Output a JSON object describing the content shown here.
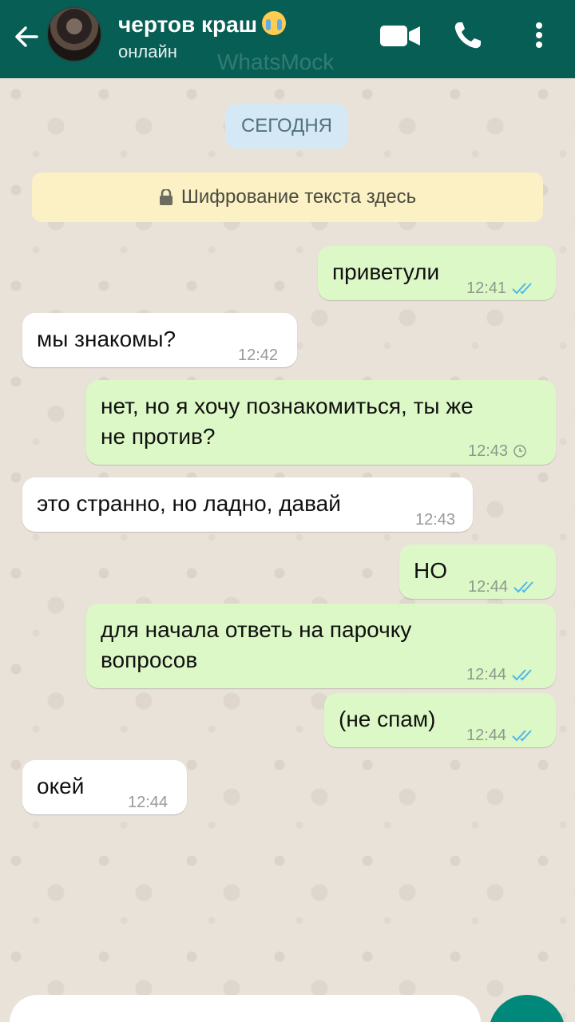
{
  "header": {
    "contact_name": "чертов краш",
    "status": "онлайн",
    "watermark": "WhatsMock",
    "icons": [
      "back-arrow-icon",
      "video-call-icon",
      "phone-icon",
      "more-vert-icon"
    ]
  },
  "chat": {
    "date_label": "СЕГОДНЯ",
    "encryption_notice": "Шифрование текста здесь",
    "messages": [
      {
        "dir": "out",
        "text": "приветули",
        "time": "12:41",
        "status": "read"
      },
      {
        "dir": "in",
        "text": "мы знакомы?",
        "time": "12:42"
      },
      {
        "dir": "out",
        "text_line1": "нет, но я хочу познакомиться, ты же",
        "text_line2": "не против?",
        "time": "12:43",
        "status": "pending"
      },
      {
        "dir": "in",
        "text": "это странно, но ладно, давай",
        "time": "12:43"
      },
      {
        "dir": "out",
        "text": "НО",
        "time": "12:44",
        "status": "read"
      },
      {
        "dir": "out",
        "text_line1": "для начала ответь на парочку",
        "text_line2": "вопросов",
        "time": "12:44",
        "status": "read"
      },
      {
        "dir": "out",
        "text": "(не спам)",
        "time": "12:44",
        "status": "read"
      },
      {
        "dir": "in",
        "text": "окей",
        "time": "12:44"
      }
    ]
  },
  "colors": {
    "header": "#075e54",
    "outgoing_bubble": "#dcf8c6",
    "incoming_bubble": "#ffffff",
    "read_tick": "#4fb6ec",
    "accent": "#00897b"
  }
}
